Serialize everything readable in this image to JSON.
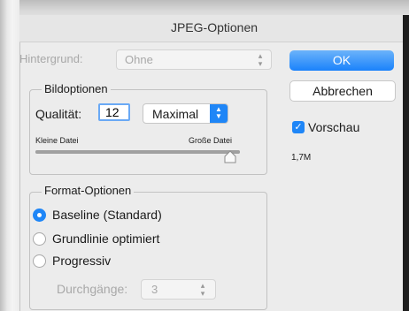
{
  "window": {
    "title": "JPEG-Optionen"
  },
  "hintergrund": {
    "label": "Hintergrund:",
    "value": "Ohne"
  },
  "buttons": {
    "ok": "OK",
    "cancel": "Abbrechen"
  },
  "preview": {
    "label": "Vorschau",
    "checked": true,
    "file_size": "1,7M"
  },
  "bildoptionen": {
    "legend": "Bildoptionen",
    "quality_label": "Qualität:",
    "quality_value": "12",
    "quality_preset": "Maximal",
    "slider_min_label": "Kleine Datei",
    "slider_max_label": "Große Datei",
    "slider_position": 1.0
  },
  "format": {
    "legend": "Format-Optionen",
    "options": [
      {
        "label": "Baseline (Standard)",
        "selected": true
      },
      {
        "label": "Grundlinie optimiert",
        "selected": false
      },
      {
        "label": "Progressiv",
        "selected": false
      }
    ],
    "passes_label": "Durchgänge:",
    "passes_value": "3"
  },
  "colors": {
    "accent": "#1f86f7",
    "disabled_text": "#a8a8a8",
    "dialog_bg": "#ececec"
  }
}
